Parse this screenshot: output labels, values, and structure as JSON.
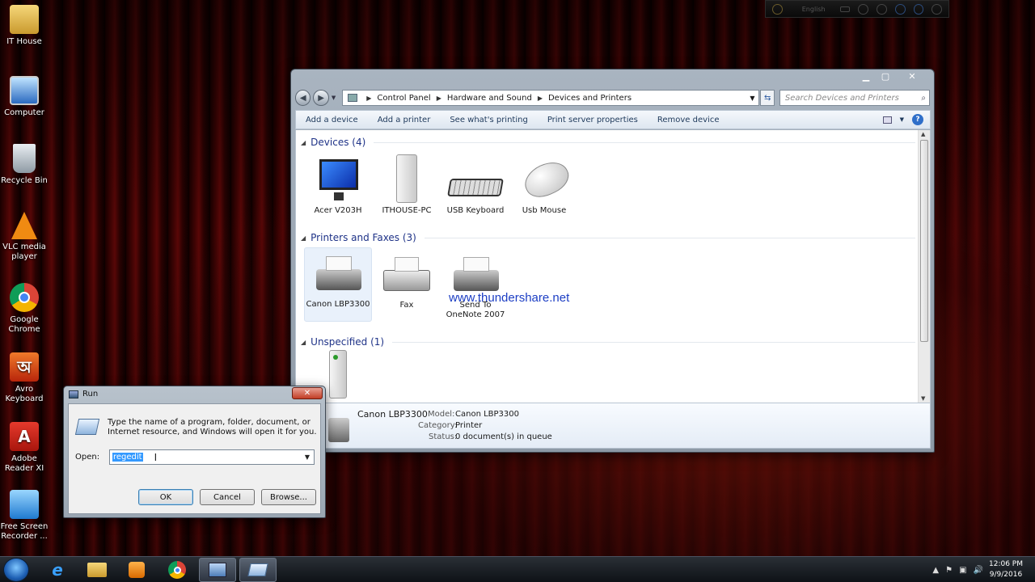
{
  "desktop": {
    "icons": [
      {
        "label": "IT House"
      },
      {
        "label": "Computer"
      },
      {
        "label": "Recycle Bin"
      },
      {
        "label": "VLC media player"
      },
      {
        "label": "Google Chrome"
      },
      {
        "label": "Avro Keyboard"
      },
      {
        "label": "Adobe Reader XI"
      },
      {
        "label": "Free Screen Recorder ..."
      }
    ]
  },
  "lang_bar": {
    "language": "English"
  },
  "explorer": {
    "breadcrumb": [
      "Control Panel",
      "Hardware and Sound",
      "Devices and Printers"
    ],
    "search_placeholder": "Search Devices and Printers",
    "commands": [
      "Add a device",
      "Add a printer",
      "See what's printing",
      "Print server properties",
      "Remove device"
    ],
    "groups": {
      "devices": {
        "title": "Devices (4)",
        "items": [
          "Acer V203H",
          "ITHOUSE-PC",
          "USB Keyboard",
          "Usb Mouse"
        ]
      },
      "printers": {
        "title": "Printers and Faxes (3)",
        "items": [
          "Canon LBP3300",
          "Fax",
          "Send To OneNote 2007"
        ]
      },
      "unspecified": {
        "title": "Unspecified (1)"
      }
    },
    "details": {
      "name": "Canon LBP3300",
      "model_label": "Model:",
      "model_value": "Canon LBP3300",
      "category_label": "Category:",
      "category_value": "Printer",
      "status_label": "Status:",
      "status_value": "0 document(s) in queue"
    }
  },
  "watermark": "www.thundershare.net",
  "run_dialog": {
    "title": "Run",
    "description": "Type the name of a program, folder, document, or Internet resource, and Windows will open it for you.",
    "open_label": "Open:",
    "open_value": "regedit",
    "ok": "OK",
    "cancel": "Cancel",
    "browse": "Browse..."
  },
  "taskbar": {
    "time": "12:06 PM",
    "date": "9/9/2016"
  },
  "colors": {
    "link_text": "#1e395b",
    "group_header": "#1e3287",
    "selection": "#3399ff",
    "watermark": "#1c3ec4"
  }
}
